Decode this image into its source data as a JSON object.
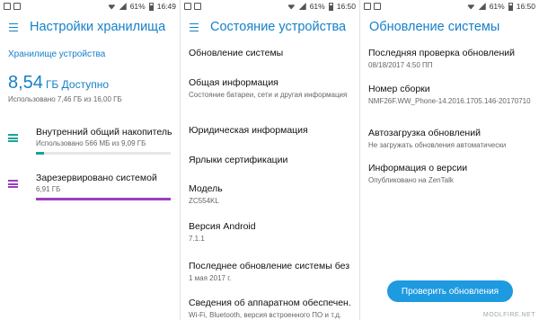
{
  "panels": [
    {
      "status": {
        "battery": "61%",
        "time": "16:49"
      },
      "title": "Настройки хранилища",
      "section": "Хранилище устройства",
      "total": {
        "value": "8,54",
        "unit": "ГБ Доступно"
      },
      "used_line": "Использовано 7,46 ГБ из 16,00 ГБ",
      "items": [
        {
          "title": "Внутренний общий накопитель",
          "subtitle": "Использовано 566 МБ из 9,09 ГБ",
          "color": "#1aa39a",
          "fill": 0.06
        },
        {
          "title": "Зарезервировано системой",
          "subtitle": "6,91 ГБ",
          "color": "#9b3fbf",
          "fill": 1.0
        }
      ]
    },
    {
      "status": {
        "battery": "61%",
        "time": "16:50"
      },
      "title": "Состояние устройства",
      "rows": [
        {
          "title": "Обновление системы",
          "subtitle": ""
        },
        {
          "title": "Общая информация",
          "subtitle": "Состояние батареи, сети и другая информация"
        },
        {
          "title": "Юридическая информация",
          "subtitle": ""
        },
        {
          "title": "Ярлыки сертификации",
          "subtitle": ""
        },
        {
          "title": "Модель",
          "subtitle": "ZC554KL"
        },
        {
          "title": "Версия Android",
          "subtitle": "7.1.1"
        },
        {
          "title": "Последнее обновление системы без...",
          "subtitle": "1 мая 2017 г."
        },
        {
          "title": "Сведения об аппаратном обеспечен...",
          "subtitle": "Wi-Fi, Bluetooth, версия встроенного ПО и т.д."
        }
      ]
    },
    {
      "status": {
        "battery": "61%",
        "time": "16:50"
      },
      "title": "Обновление системы",
      "rows": [
        {
          "title": "Последняя проверка обновлений",
          "subtitle": "08/18/2017 4:50 ПП"
        },
        {
          "title": "Номер сборки",
          "subtitle": "NMF26F.WW_Phone-14.2016.1705.146-20170710"
        },
        {
          "title": "Автозагрузка обновлений",
          "subtitle": "Не загружать обновления автоматически"
        },
        {
          "title": "Информация о версии",
          "subtitle": "Опубликовано на ZenTalk"
        }
      ],
      "button": "Проверить обновления"
    }
  ],
  "watermark": "MODLFIRE.NET"
}
